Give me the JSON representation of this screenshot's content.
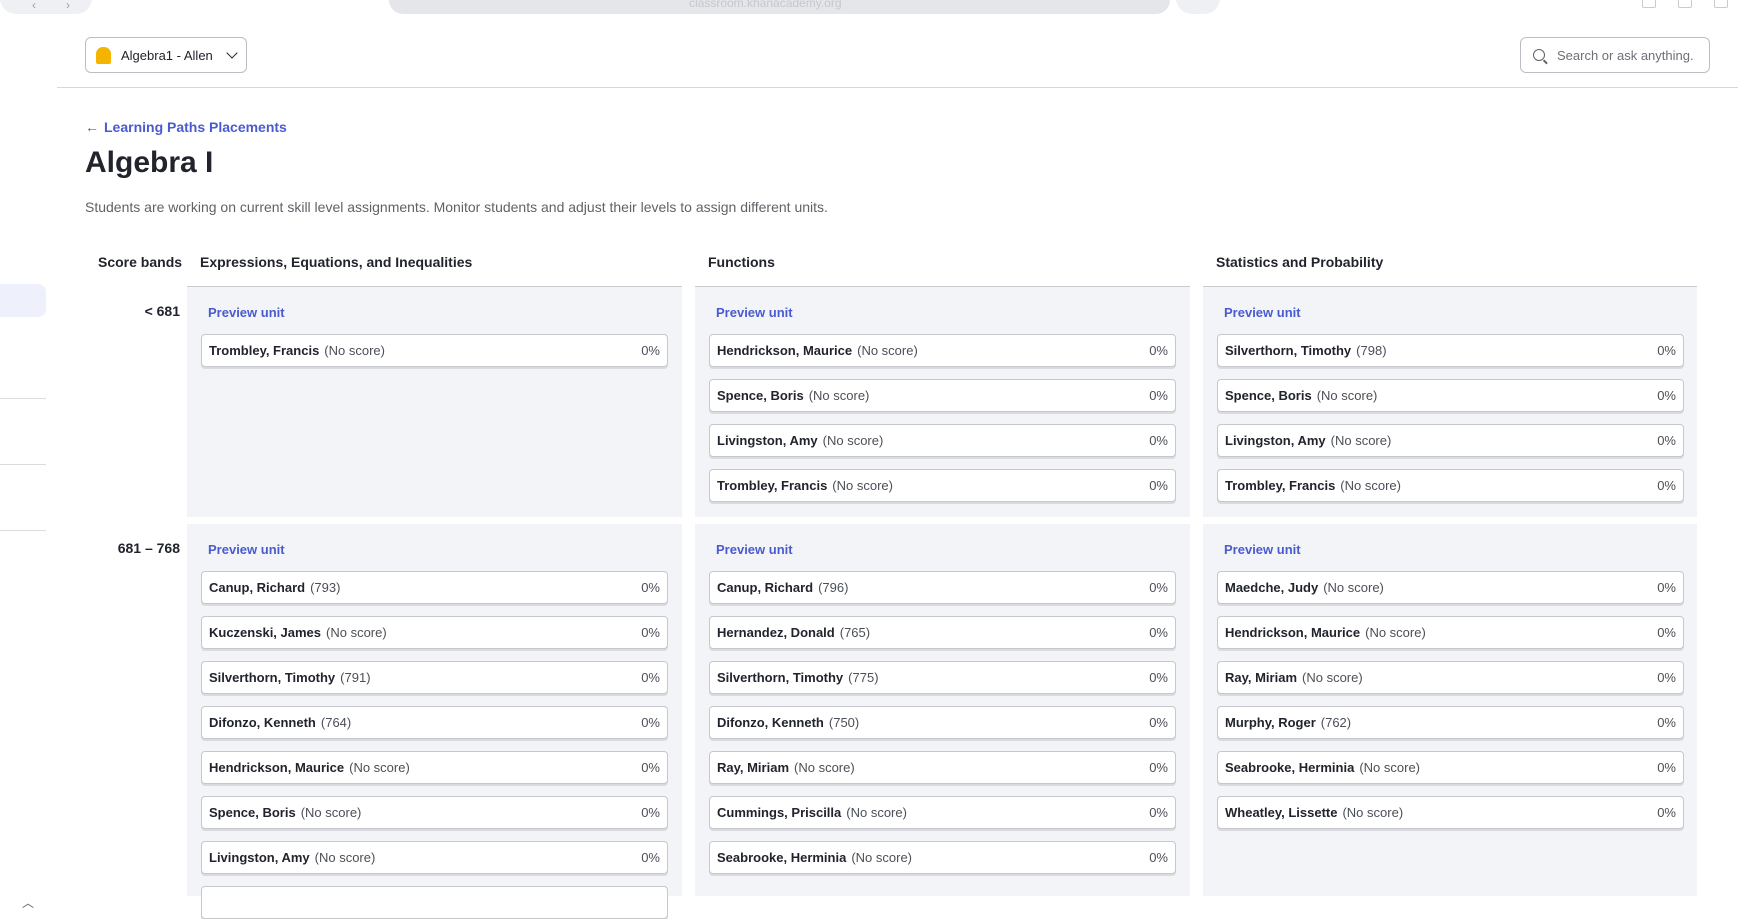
{
  "browser": {
    "url": "classroom.khanacademy.org"
  },
  "header": {
    "class_name": "Algebra1 - Allen",
    "search_placeholder": "Search or ask anything..."
  },
  "page": {
    "back_label": "Learning Paths Placements",
    "title": "Algebra I",
    "subtitle": "Students are working on current skill level assignments. Monitor students and adjust their levels to assign different units."
  },
  "grid": {
    "score_bands_header": "Score bands",
    "columns": [
      "Expressions, Equations, and Inequalities",
      "Functions",
      "Statistics and Probability"
    ],
    "preview_label": "Preview unit",
    "bands": [
      {
        "label": "< 681",
        "columns": [
          [
            {
              "name": "Trombley, Francis",
              "score": "(No score)",
              "pct": "0%"
            }
          ],
          [
            {
              "name": "Hendrickson, Maurice",
              "score": "(No score)",
              "pct": "0%"
            },
            {
              "name": "Spence, Boris",
              "score": "(No score)",
              "pct": "0%"
            },
            {
              "name": "Livingston, Amy",
              "score": "(No score)",
              "pct": "0%"
            },
            {
              "name": "Trombley, Francis",
              "score": "(No score)",
              "pct": "0%"
            }
          ],
          [
            {
              "name": "Silverthorn, Timothy",
              "score": "(798)",
              "pct": "0%"
            },
            {
              "name": "Spence, Boris",
              "score": "(No score)",
              "pct": "0%"
            },
            {
              "name": "Livingston, Amy",
              "score": "(No score)",
              "pct": "0%"
            },
            {
              "name": "Trombley, Francis",
              "score": "(No score)",
              "pct": "0%"
            }
          ]
        ]
      },
      {
        "label": "681 – 768",
        "columns": [
          [
            {
              "name": "Canup, Richard",
              "score": "(793)",
              "pct": "0%"
            },
            {
              "name": "Kuczenski, James",
              "score": "(No score)",
              "pct": "0%"
            },
            {
              "name": "Silverthorn, Timothy",
              "score": "(791)",
              "pct": "0%"
            },
            {
              "name": "Difonzo, Kenneth",
              "score": "(764)",
              "pct": "0%"
            },
            {
              "name": "Hendrickson, Maurice",
              "score": "(No score)",
              "pct": "0%"
            },
            {
              "name": "Spence, Boris",
              "score": "(No score)",
              "pct": "0%"
            },
            {
              "name": "Livingston, Amy",
              "score": "(No score)",
              "pct": "0%"
            },
            {
              "name": "",
              "score": "",
              "pct": ""
            }
          ],
          [
            {
              "name": "Canup, Richard",
              "score": "(796)",
              "pct": "0%"
            },
            {
              "name": "Hernandez, Donald",
              "score": "(765)",
              "pct": "0%"
            },
            {
              "name": "Silverthorn, Timothy",
              "score": "(775)",
              "pct": "0%"
            },
            {
              "name": "Difonzo, Kenneth",
              "score": "(750)",
              "pct": "0%"
            },
            {
              "name": "Ray, Miriam",
              "score": "(No score)",
              "pct": "0%"
            },
            {
              "name": "Cummings, Priscilla",
              "score": "(No score)",
              "pct": "0%"
            },
            {
              "name": "Seabrooke, Herminia",
              "score": "(No score)",
              "pct": "0%"
            }
          ],
          [
            {
              "name": "Maedche, Judy",
              "score": "(No score)",
              "pct": "0%"
            },
            {
              "name": "Hendrickson, Maurice",
              "score": "(No score)",
              "pct": "0%"
            },
            {
              "name": "Ray, Miriam",
              "score": "(No score)",
              "pct": "0%"
            },
            {
              "name": "Murphy, Roger",
              "score": "(762)",
              "pct": "0%"
            },
            {
              "name": "Seabrooke, Herminia",
              "score": "(No score)",
              "pct": "0%"
            },
            {
              "name": "Wheatley, Lissette",
              "score": "(No score)",
              "pct": "0%"
            }
          ]
        ]
      }
    ]
  }
}
